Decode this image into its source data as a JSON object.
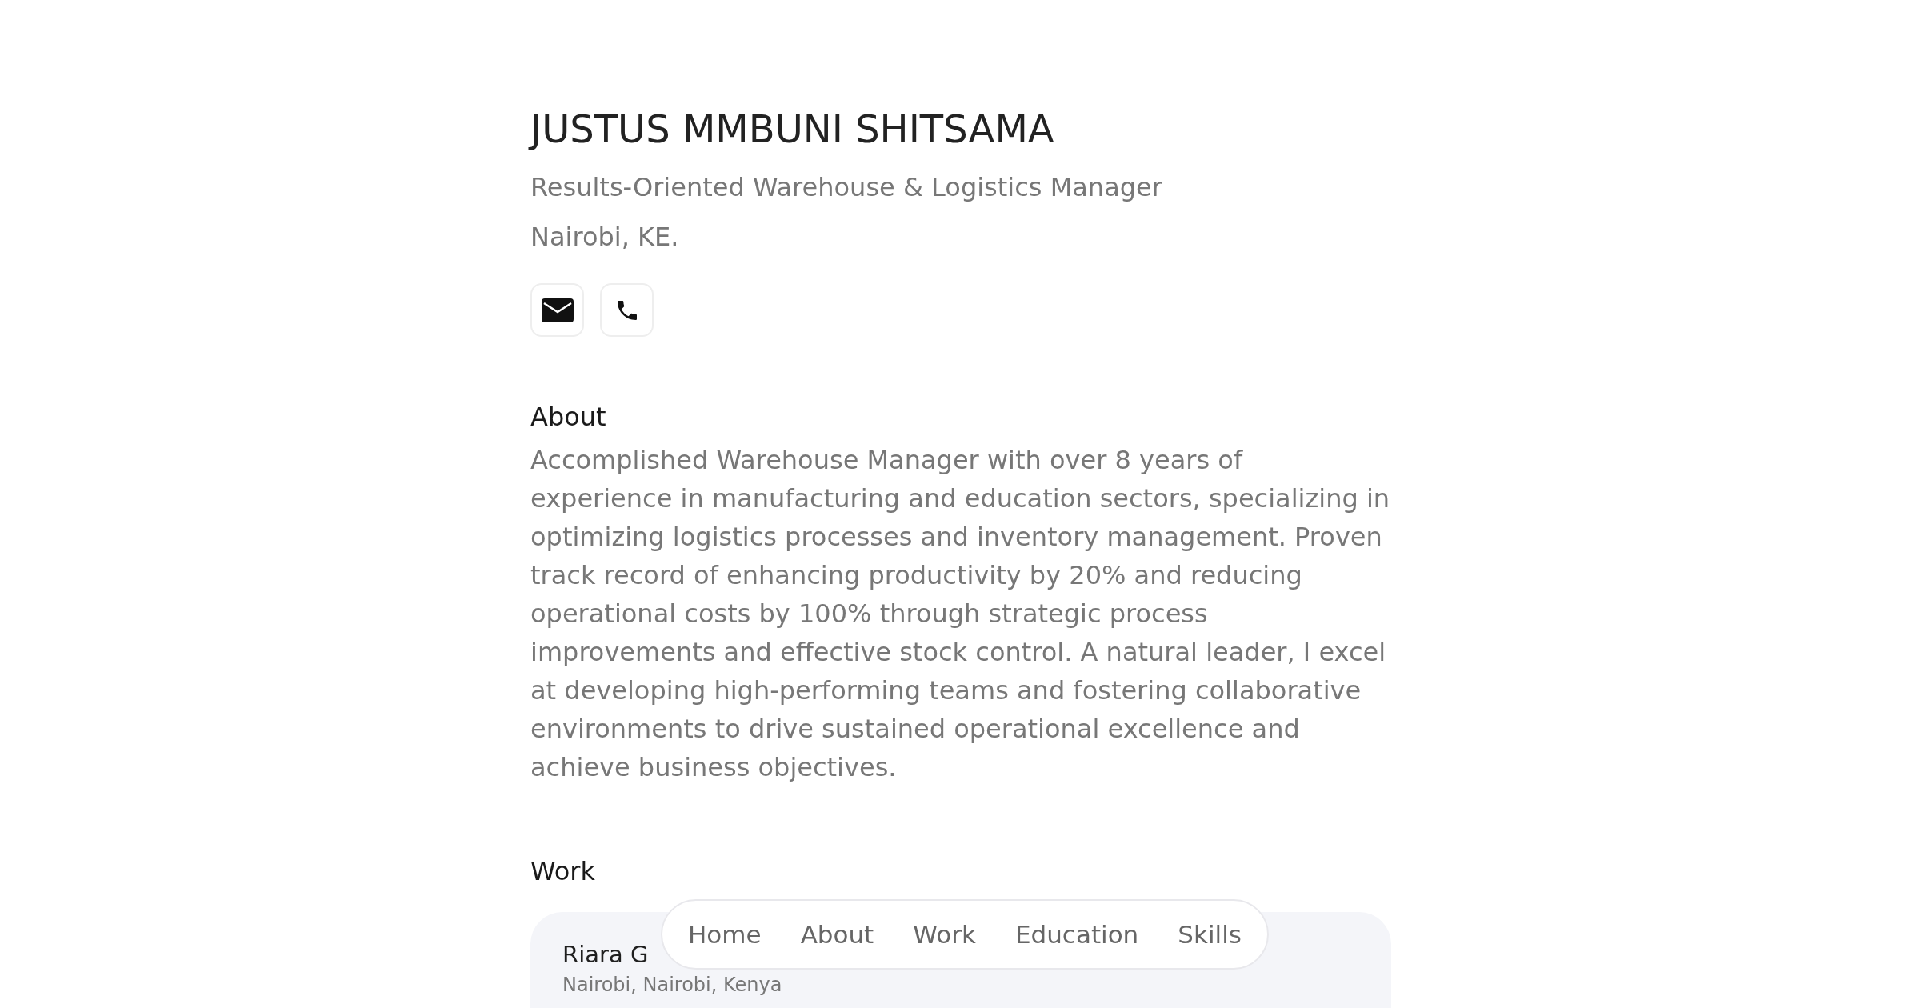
{
  "profile": {
    "name": "JUSTUS MMBUNI SHITSAMA",
    "headline": "Results-Oriented Warehouse & Logistics Manager",
    "location": "Nairobi, KE.",
    "contacts": [
      {
        "kind": "email"
      },
      {
        "kind": "phone"
      }
    ]
  },
  "about": {
    "heading": "About",
    "text": "Accomplished Warehouse Manager with over 8 years of experience in manufacturing and education sectors, specializing in optimizing logistics processes and inventory management. Proven track record of enhancing productivity by 20% and reducing operational costs by 100% through strategic process improvements and effective stock control. A natural leader, I excel at developing high-performing teams and fostering collaborative environments to drive sustained operational excellence and achieve business objectives."
  },
  "work": {
    "heading": "Work",
    "jobs": [
      {
        "title": "Riara G",
        "location": "Nairobi, Nairobi, Kenya"
      }
    ]
  },
  "nav": [
    {
      "label": "Home"
    },
    {
      "label": "About"
    },
    {
      "label": "Work"
    },
    {
      "label": "Education"
    },
    {
      "label": "Skills"
    }
  ]
}
